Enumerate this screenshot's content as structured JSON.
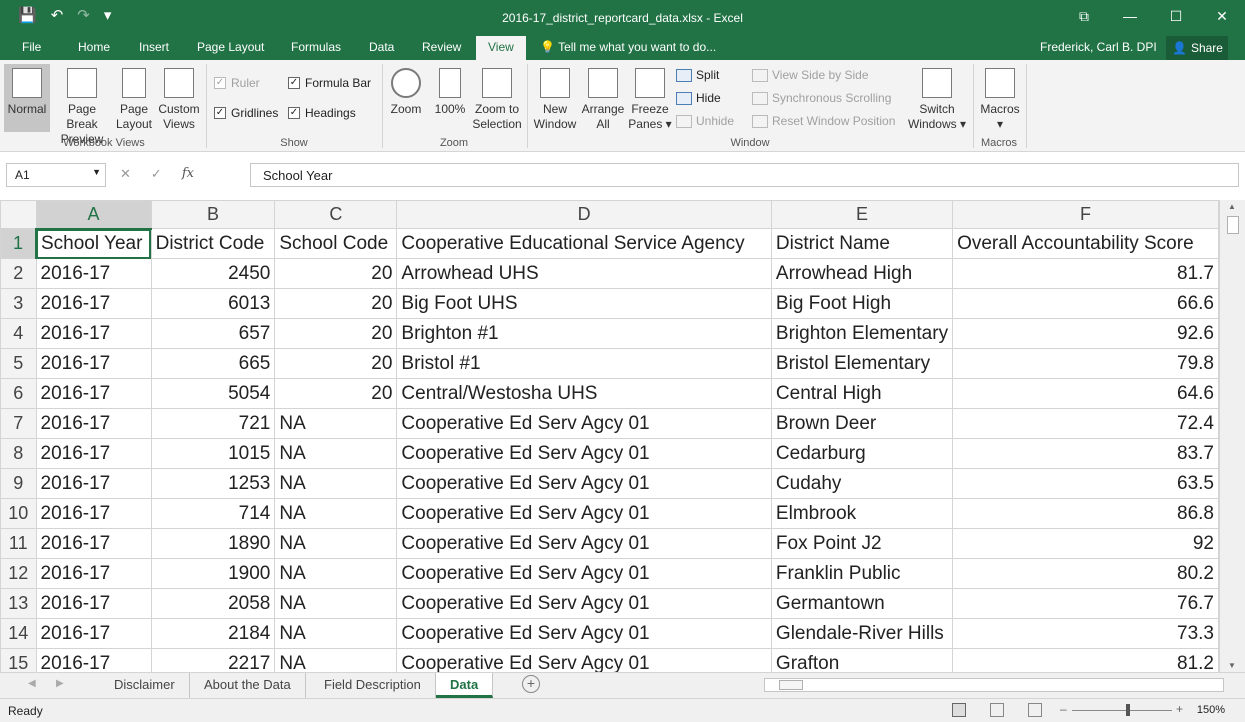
{
  "window": {
    "title": "2016-17_district_reportcard_data.xlsx - Excel",
    "qat": {
      "save": "💾",
      "undo": "↶",
      "redo": "↷",
      "more": "▾"
    },
    "controls": {
      "restore_ribbon": "⧉",
      "minimize": "—",
      "maximize": "☐",
      "close": "✕"
    }
  },
  "tabs": {
    "file": "File",
    "home": "Home",
    "insert": "Insert",
    "page_layout": "Page Layout",
    "formulas": "Formulas",
    "data": "Data",
    "review": "Review",
    "view": "View",
    "tell_me": "Tell me what you want to do...",
    "user": "Frederick, Carl B.  DPI",
    "share": "Share"
  },
  "ribbon": {
    "workbook_views": {
      "label": "Workbook Views",
      "normal": "Normal",
      "page_break": [
        "Page Break",
        "Preview"
      ],
      "page_layout": [
        "Page",
        "Layout"
      ],
      "custom_views": [
        "Custom",
        "Views"
      ]
    },
    "show": {
      "label": "Show",
      "ruler": "Ruler",
      "gridlines": "Gridlines",
      "formula_bar": "Formula Bar",
      "headings": "Headings"
    },
    "zoom": {
      "label": "Zoom",
      "zoom": "Zoom",
      "hundred": "100%",
      "zoom_to_selection": [
        "Zoom to",
        "Selection"
      ]
    },
    "window": {
      "label": "Window",
      "new_window": [
        "New",
        "Window"
      ],
      "arrange_all": [
        "Arrange",
        "All"
      ],
      "freeze_panes": [
        "Freeze",
        "Panes ▾"
      ],
      "split": "Split",
      "hide": "Hide",
      "unhide": "Unhide",
      "view_side_by_side": "View Side by Side",
      "sync_scrolling": "Synchronous Scrolling",
      "reset_window_position": "Reset Window Position",
      "switch_windows": [
        "Switch",
        "Windows ▾"
      ]
    },
    "macros": {
      "label": "Macros",
      "macros": "Macros",
      "arrow": "▾"
    }
  },
  "formula_bar": {
    "name_box": "A1",
    "cancel": "✕",
    "enter": "✓",
    "fx": "fx",
    "content": "School Year"
  },
  "sheet": {
    "columns": [
      "A",
      "B",
      "C",
      "D",
      "E",
      "F"
    ],
    "rows": [
      {
        "n": "1",
        "a": "School Year",
        "b": "District Code",
        "c": "School Code",
        "d": "Cooperative Educational Service Agency",
        "e": "District Name",
        "f": "Overall Accountability Score"
      },
      {
        "n": "2",
        "a": "2016-17",
        "b": "2450",
        "c": "20",
        "d": "Arrowhead UHS",
        "e": "Arrowhead High",
        "f": "81.7"
      },
      {
        "n": "3",
        "a": "2016-17",
        "b": "6013",
        "c": "20",
        "d": "Big Foot UHS",
        "e": "Big Foot High",
        "f": "66.6"
      },
      {
        "n": "4",
        "a": "2016-17",
        "b": "657",
        "c": "20",
        "d": "Brighton #1",
        "e": "Brighton Elementary",
        "f": "92.6"
      },
      {
        "n": "5",
        "a": "2016-17",
        "b": "665",
        "c": "20",
        "d": "Bristol #1",
        "e": "Bristol Elementary",
        "f": "79.8"
      },
      {
        "n": "6",
        "a": "2016-17",
        "b": "5054",
        "c": "20",
        "d": "Central/Westosha UHS",
        "e": "Central High",
        "f": "64.6"
      },
      {
        "n": "7",
        "a": "2016-17",
        "b": "721",
        "c": "NA",
        "d": "Cooperative Ed Serv Agcy 01",
        "e": "Brown Deer",
        "f": "72.4"
      },
      {
        "n": "8",
        "a": "2016-17",
        "b": "1015",
        "c": "NA",
        "d": "Cooperative Ed Serv Agcy 01",
        "e": "Cedarburg",
        "f": "83.7"
      },
      {
        "n": "9",
        "a": "2016-17",
        "b": "1253",
        "c": "NA",
        "d": "Cooperative Ed Serv Agcy 01",
        "e": "Cudahy",
        "f": "63.5"
      },
      {
        "n": "10",
        "a": "2016-17",
        "b": "714",
        "c": "NA",
        "d": "Cooperative Ed Serv Agcy 01",
        "e": "Elmbrook",
        "f": "86.8"
      },
      {
        "n": "11",
        "a": "2016-17",
        "b": "1890",
        "c": "NA",
        "d": "Cooperative Ed Serv Agcy 01",
        "e": "Fox Point J2",
        "f": "92"
      },
      {
        "n": "12",
        "a": "2016-17",
        "b": "1900",
        "c": "NA",
        "d": "Cooperative Ed Serv Agcy 01",
        "e": "Franklin Public",
        "f": "80.2"
      },
      {
        "n": "13",
        "a": "2016-17",
        "b": "2058",
        "c": "NA",
        "d": "Cooperative Ed Serv Agcy 01",
        "e": "Germantown",
        "f": "76.7"
      },
      {
        "n": "14",
        "a": "2016-17",
        "b": "2184",
        "c": "NA",
        "d": "Cooperative Ed Serv Agcy 01",
        "e": "Glendale-River Hills",
        "f": "73.3"
      },
      {
        "n": "15",
        "a": "2016-17",
        "b": "2217",
        "c": "NA",
        "d": "Cooperative Ed Serv Agcy 01",
        "e": "Grafton",
        "f": "81.2"
      }
    ]
  },
  "sheet_tabs": [
    "Disclaimer",
    "About the Data",
    "Field Description",
    "Data"
  ],
  "active_sheet": "Data",
  "status": {
    "ready": "Ready",
    "zoom": "150%"
  }
}
